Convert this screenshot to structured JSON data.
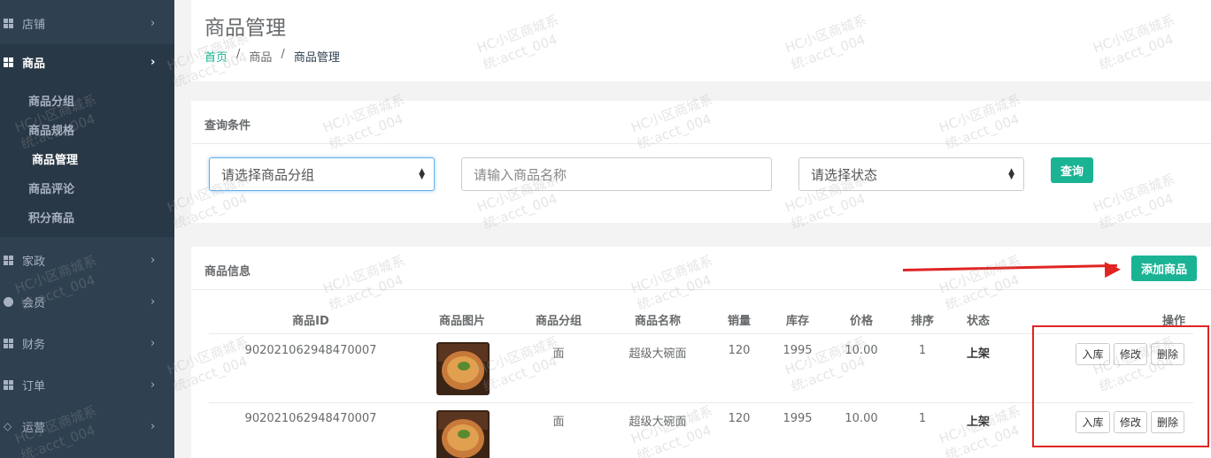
{
  "sidebar": {
    "items": [
      {
        "label": "店铺",
        "icon": "grid-icon"
      },
      {
        "label": "商品",
        "icon": "grid-icon"
      },
      {
        "label": "家政",
        "icon": "grid-icon"
      },
      {
        "label": "会员",
        "icon": "globe-icon"
      },
      {
        "label": "财务",
        "icon": "grid-icon"
      },
      {
        "label": "订单",
        "icon": "grid-icon"
      },
      {
        "label": "运营",
        "icon": "diamond-icon"
      }
    ],
    "sub_items": [
      "商品分组",
      "商品规格",
      "商品管理",
      "商品评论",
      "积分商品"
    ],
    "chevron": "›"
  },
  "header": {
    "title": "商品管理",
    "breadcrumb": [
      "首页",
      "商品",
      "商品管理"
    ],
    "separator": "/"
  },
  "query": {
    "title": "查询条件",
    "group_select": "请选择商品分组",
    "name_placeholder": "请输入商品名称",
    "status_select": "请选择状态",
    "search_button": "查询"
  },
  "products": {
    "title": "商品信息",
    "add_button": "添加商品",
    "columns": [
      "商品ID",
      "商品图片",
      "商品分组",
      "商品名称",
      "销量",
      "库存",
      "价格",
      "排序",
      "状态",
      "操作"
    ],
    "rows": [
      {
        "id": "902021062948470007",
        "group": "面",
        "name": "超级大碗面",
        "sales": "120",
        "stock": "1995",
        "price": "10.00",
        "sort": "1",
        "status": "上架"
      },
      {
        "id": "902021062948470007",
        "group": "面",
        "name": "超级大碗面",
        "sales": "120",
        "stock": "1995",
        "price": "10.00",
        "sort": "1",
        "status": "上架"
      }
    ],
    "actions": {
      "stock_in": "入库",
      "edit": "修改",
      "delete": "删除"
    }
  },
  "watermark": {
    "line1": "HC小区商城系",
    "line2": "统:acct_004"
  },
  "colors": {
    "primary": "#1ab394",
    "sidebar": "#2f4050",
    "annotation": "#e02424"
  }
}
